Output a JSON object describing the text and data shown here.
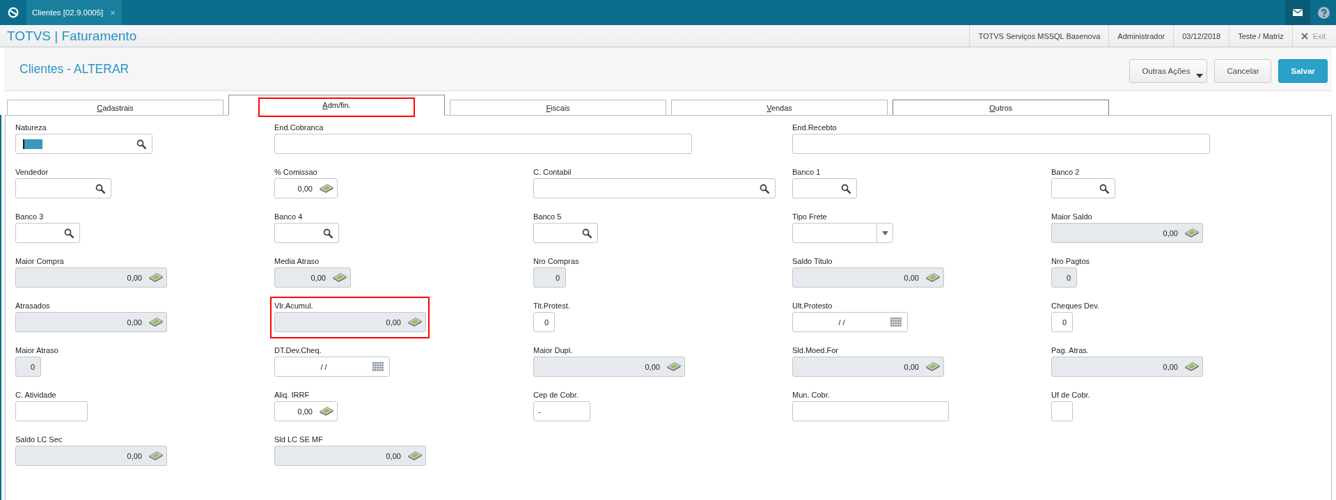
{
  "top_bar": {
    "tab": {
      "label": "Clientes [02.9.0005]",
      "close": "×"
    }
  },
  "app_header": {
    "title": "TOTVS | Faturamento",
    "info": [
      "TOTVS Serviços MSSQL Basenova",
      "Administrador",
      "03/12/2018",
      "Teste / Matriz"
    ],
    "exit": "Exit"
  },
  "page": {
    "title": "Clientes - ALTERAR",
    "actions": [
      {
        "label": "Outras Ações",
        "kind": "menu"
      },
      {
        "label": "Cancelar",
        "kind": "secondary"
      },
      {
        "label": "Salvar",
        "kind": "primary"
      }
    ]
  },
  "tabs": [
    {
      "label": "Cadastrais",
      "selected": false,
      "hovered": false,
      "highlighted": false
    },
    {
      "label": "Adm/fin.",
      "selected": true,
      "hovered": false,
      "highlighted": true
    },
    {
      "label": "Fiscais",
      "selected": false,
      "hovered": false,
      "highlighted": false
    },
    {
      "label": "Vendas",
      "selected": false,
      "hovered": false,
      "highlighted": false
    },
    {
      "label": "Outros",
      "selected": false,
      "hovered": true,
      "highlighted": false
    }
  ],
  "form": {
    "rows": [
      [
        {
          "label": "Natureza",
          "kind": "lookup",
          "readonly": false,
          "focused": true,
          "highlighted": false
        },
        {
          "label": "End.Cobranca",
          "kind": "text",
          "readonly": false,
          "focused": false,
          "highlighted": false
        },
        "",
        {
          "label": "End.Recebto",
          "kind": "text",
          "readonly": false,
          "focused": false,
          "highlighted": false
        }
      ],
      [
        {
          "label": "Vendedor",
          "kind": "lookup",
          "readonly": false,
          "focused": false,
          "highlighted": false
        },
        {
          "label": "% Comissao",
          "kind": "currency",
          "value": "0,00",
          "readonly": false,
          "focused": false,
          "highlighted": false
        },
        {
          "label": "C. Contabil",
          "kind": "lookup",
          "readonly": false,
          "focused": false,
          "highlighted": false
        },
        {
          "label": "Banco 1",
          "kind": "lookup",
          "readonly": false,
          "focused": false,
          "highlighted": false
        },
        {
          "label": "Banco 2",
          "kind": "lookup",
          "readonly": false,
          "focused": false,
          "highlighted": false
        }
      ],
      [
        {
          "label": "Banco 3",
          "kind": "lookup",
          "readonly": false,
          "focused": false,
          "highlighted": false
        },
        {
          "label": "Banco 4",
          "kind": "lookup",
          "readonly": false,
          "focused": false,
          "highlighted": false
        },
        {
          "label": "Banco 5",
          "kind": "lookup",
          "readonly": false,
          "focused": false,
          "highlighted": false
        },
        {
          "label": "Tipo Frete",
          "kind": "select",
          "readonly": false,
          "focused": false,
          "highlighted": false
        },
        {
          "label": "Maior Saldo",
          "kind": "currency",
          "value": "0,00",
          "readonly": true,
          "focused": false,
          "highlighted": false
        }
      ],
      [
        {
          "label": "Maior Compra",
          "kind": "currency",
          "value": "0,00",
          "readonly": true,
          "focused": false,
          "highlighted": false
        },
        {
          "label": "Media Atraso",
          "kind": "currency",
          "value": "0,00",
          "readonly": true,
          "focused": false,
          "highlighted": false
        },
        {
          "label": "Nro Compras",
          "kind": "number",
          "value": "0",
          "readonly": true,
          "focused": false,
          "highlighted": false
        },
        {
          "label": "Saldo Titulo",
          "kind": "currency",
          "value": "0,00",
          "readonly": true,
          "focused": false,
          "highlighted": false
        },
        {
          "label": "Nro Pagtos",
          "kind": "number",
          "value": "0",
          "readonly": true,
          "focused": false,
          "highlighted": false
        }
      ],
      [
        {
          "label": "Atrasados",
          "kind": "currency",
          "value": "0,00",
          "readonly": true,
          "focused": false,
          "highlighted": false
        },
        {
          "label": "Vlr.Acumul.",
          "kind": "currency",
          "value": "0,00",
          "readonly": true,
          "focused": false,
          "highlighted": true
        },
        {
          "label": "Tit.Protest.",
          "kind": "number",
          "value": "0",
          "readonly": false,
          "focused": false,
          "highlighted": false
        },
        {
          "label": "Ult.Protesto",
          "kind": "date",
          "value": "/ /",
          "readonly": false,
          "focused": false,
          "highlighted": false
        },
        {
          "label": "Cheques Dev.",
          "kind": "number",
          "value": "0",
          "readonly": false,
          "focused": false,
          "highlighted": false
        }
      ],
      [
        {
          "label": "Maior Atraso",
          "kind": "number",
          "value": "0",
          "readonly": true,
          "focused": false,
          "highlighted": false
        },
        {
          "label": "DT.Dev.Cheq.",
          "kind": "date",
          "value": "/ /",
          "readonly": false,
          "focused": false,
          "highlighted": false
        },
        {
          "label": "Maior Dupl.",
          "kind": "currency",
          "value": "0,00",
          "readonly": true,
          "focused": false,
          "highlighted": false
        },
        {
          "label": "Sld.Moed.For",
          "kind": "currency",
          "value": "0,00",
          "readonly": true,
          "focused": false,
          "highlighted": false
        },
        {
          "label": "Pag. Atras.",
          "kind": "currency",
          "value": "0,00",
          "readonly": true,
          "focused": false,
          "highlighted": false
        }
      ],
      [
        {
          "label": "C. Atividade",
          "kind": "text",
          "readonly": false,
          "focused": false,
          "highlighted": false
        },
        {
          "label": "Aliq. IRRF",
          "kind": "currency",
          "value": "0,00",
          "readonly": false,
          "focused": false,
          "highlighted": false
        },
        {
          "label": "Cep de Cobr.",
          "kind": "text",
          "value": "-",
          "readonly": false,
          "focused": false,
          "highlighted": false
        },
        {
          "label": "Mun. Cobr.",
          "kind": "text",
          "readonly": false,
          "focused": false,
          "highlighted": false
        },
        {
          "label": "Uf de Cobr.",
          "kind": "text",
          "readonly": false,
          "focused": false,
          "highlighted": false
        }
      ],
      [
        {
          "label": "Saldo LC Sec",
          "kind": "currency",
          "value": "0,00",
          "readonly": true,
          "focused": false,
          "highlighted": false
        },
        {
          "label": "Sld LC SE MF",
          "kind": "currency",
          "value": "0,00",
          "readonly": true,
          "focused": false,
          "highlighted": false
        }
      ]
    ]
  }
}
